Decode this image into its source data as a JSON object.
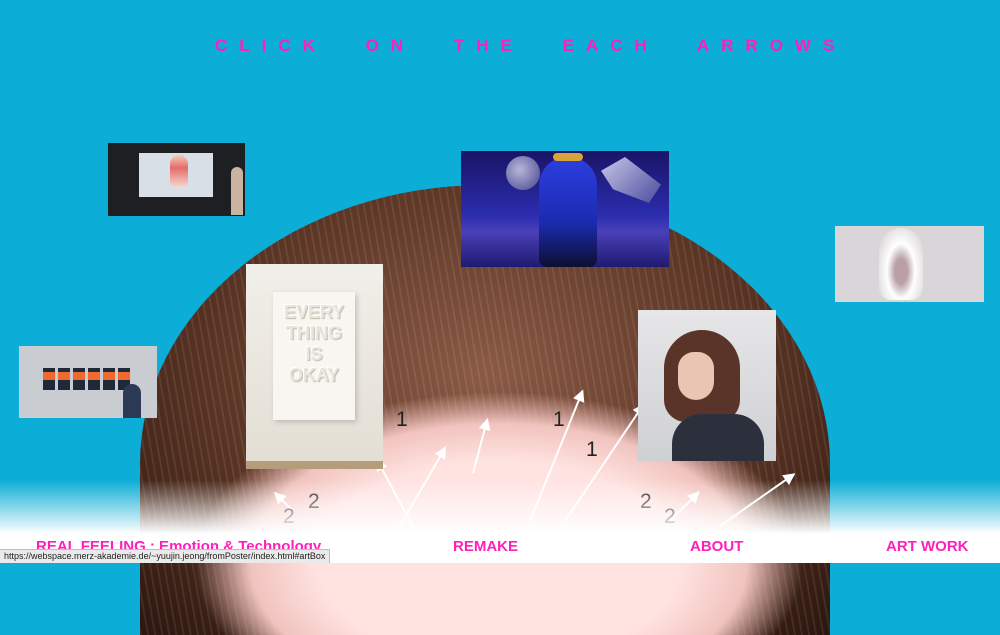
{
  "header": {
    "title": "CLICK ON THE EACH ARROWS"
  },
  "colors": {
    "background": "#0cadd6",
    "accent": "#ff1fb9",
    "footer": "#ffffff"
  },
  "scalp": {
    "numbers": [
      "1",
      "1",
      "1",
      "2",
      "2",
      "2",
      "2"
    ]
  },
  "poster": {
    "lines": [
      "EVERY",
      "THING",
      "IS",
      "OKAY"
    ]
  },
  "nav": {
    "items": [
      {
        "label": "REAL FEELING : Emotion & Technology"
      },
      {
        "label": "REMAKE"
      },
      {
        "label": "ABOUT"
      },
      {
        "label": "ART WORK"
      }
    ]
  },
  "status_bar": {
    "url": "https://webspace.merz-akademie.de/~yuujin.jeong/fromPoster/index.html#artBox"
  }
}
